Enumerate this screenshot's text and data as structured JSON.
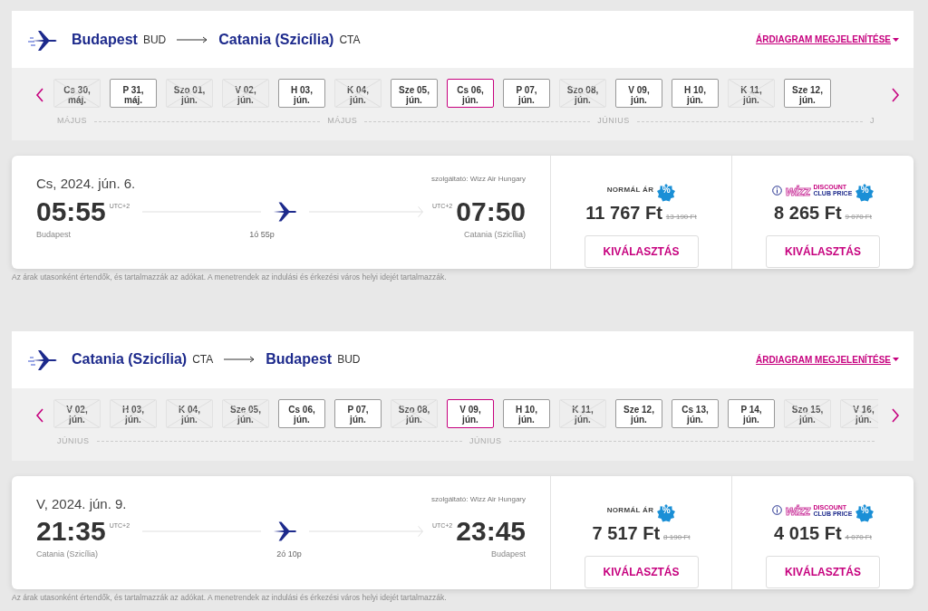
{
  "sections": [
    {
      "route": {
        "origin": "Budapest",
        "origin_code": "BUD",
        "destination": "Catania (Szicília)",
        "destination_code": "CTA"
      },
      "chart_link": "ÁRDIAGRAM MEGJELENÍTÉSE",
      "dates": [
        {
          "day": "Cs 30,",
          "month": "máj.",
          "available": false,
          "selected": false
        },
        {
          "day": "P 31,",
          "month": "máj.",
          "available": true,
          "selected": false
        },
        {
          "day": "Szo 01,",
          "month": "jún.",
          "available": false,
          "selected": false
        },
        {
          "day": "V 02,",
          "month": "jún.",
          "available": false,
          "selected": false
        },
        {
          "day": "H 03,",
          "month": "jún.",
          "available": true,
          "selected": false
        },
        {
          "day": "K 04,",
          "month": "jún.",
          "available": false,
          "selected": false
        },
        {
          "day": "Sze 05,",
          "month": "jún.",
          "available": true,
          "selected": false
        },
        {
          "day": "Cs 06,",
          "month": "jún.",
          "available": true,
          "selected": true
        },
        {
          "day": "P 07,",
          "month": "jún.",
          "available": true,
          "selected": false
        },
        {
          "day": "Szo 08,",
          "month": "jún.",
          "available": false,
          "selected": false
        },
        {
          "day": "V 09,",
          "month": "jún.",
          "available": true,
          "selected": false
        },
        {
          "day": "H 10,",
          "month": "jún.",
          "available": true,
          "selected": false
        },
        {
          "day": "K 11,",
          "month": "jún.",
          "available": false,
          "selected": false
        },
        {
          "day": "Sze 12,",
          "month": "jún.",
          "available": true,
          "selected": false
        }
      ],
      "months": [
        "MÁJUS",
        "MÁJUS",
        "JÚNIUS",
        "J"
      ],
      "flight": {
        "date": "Cs, 2024. jún. 6.",
        "operator": "szolgáltató: Wizz Air Hungary",
        "departure": "05:55",
        "departure_tz": "UTC+2",
        "arrival": "07:50",
        "arrival_tz": "UTC+2",
        "from": "Budapest",
        "to": "Catania (Szicília)",
        "duration": "1ó 55p"
      },
      "fares": [
        {
          "kind": "normal",
          "label": "NORMÁL ÁR",
          "badge": "%",
          "price": "11 767 Ft",
          "old_price": "13 190 Ft",
          "button": "KIVÁLASZTÁS"
        },
        {
          "kind": "club",
          "logo": "wizz",
          "club_line1": "DISCOUNT",
          "club_line2": "CLUB PRICE",
          "badge": "%",
          "price": "8 265 Ft",
          "old_price": "9 070 Ft",
          "button": "KIVÁLASZTÁS"
        }
      ],
      "note": "Az árak utasonként értendők, és tartalmazzák az adókat. A menetrendek az indulási és érkezési város helyi idejét tartalmazzák."
    },
    {
      "route": {
        "origin": "Catania (Szicília)",
        "origin_code": "CTA",
        "destination": "Budapest",
        "destination_code": "BUD"
      },
      "chart_link": "ÁRDIAGRAM MEGJELENÍTÉSE",
      "dates": [
        {
          "day": "V 02,",
          "month": "jún.",
          "available": false,
          "selected": false
        },
        {
          "day": "H 03,",
          "month": "jún.",
          "available": false,
          "selected": false
        },
        {
          "day": "K 04,",
          "month": "jún.",
          "available": false,
          "selected": false
        },
        {
          "day": "Sze 05,",
          "month": "jún.",
          "available": false,
          "selected": false
        },
        {
          "day": "Cs 06,",
          "month": "jún.",
          "available": true,
          "selected": false
        },
        {
          "day": "P 07,",
          "month": "jún.",
          "available": true,
          "selected": false
        },
        {
          "day": "Szo 08,",
          "month": "jún.",
          "available": false,
          "selected": false
        },
        {
          "day": "V 09,",
          "month": "jún.",
          "available": true,
          "selected": true
        },
        {
          "day": "H 10,",
          "month": "jún.",
          "available": true,
          "selected": false
        },
        {
          "day": "K 11,",
          "month": "jún.",
          "available": false,
          "selected": false
        },
        {
          "day": "Sze 12,",
          "month": "jún.",
          "available": true,
          "selected": false
        },
        {
          "day": "Cs 13,",
          "month": "jún.",
          "available": true,
          "selected": false
        },
        {
          "day": "P 14,",
          "month": "jún.",
          "available": true,
          "selected": false
        },
        {
          "day": "Szo 15,",
          "month": "jún.",
          "available": false,
          "selected": false
        },
        {
          "day": "V 16,",
          "month": "jún.",
          "available": false,
          "selected": false
        }
      ],
      "months": [
        "JÚNIUS",
        "JÚNIUS"
      ],
      "flight": {
        "date": "V, 2024. jún. 9.",
        "operator": "szolgáltató: Wizz Air Hungary",
        "departure": "21:35",
        "departure_tz": "UTC+2",
        "arrival": "23:45",
        "arrival_tz": "UTC+2",
        "from": "Catania (Szicília)",
        "to": "Budapest",
        "duration": "2ó 10p"
      },
      "fares": [
        {
          "kind": "normal",
          "label": "NORMÁL ÁR",
          "badge": "%",
          "price": "7 517 Ft",
          "old_price": "8 190 Ft",
          "button": "KIVÁLASZTÁS"
        },
        {
          "kind": "club",
          "logo": "wizz",
          "club_line1": "DISCOUNT",
          "club_line2": "CLUB PRICE",
          "badge": "%",
          "price": "4 015 Ft",
          "old_price": "4 070 Ft",
          "button": "KIVÁLASZTÁS"
        }
      ],
      "note": "Az árak utasonként értendők, és tartalmazzák az adókat. A menetrendek az indulási és érkezési város helyi idejét tartalmazzák."
    }
  ]
}
